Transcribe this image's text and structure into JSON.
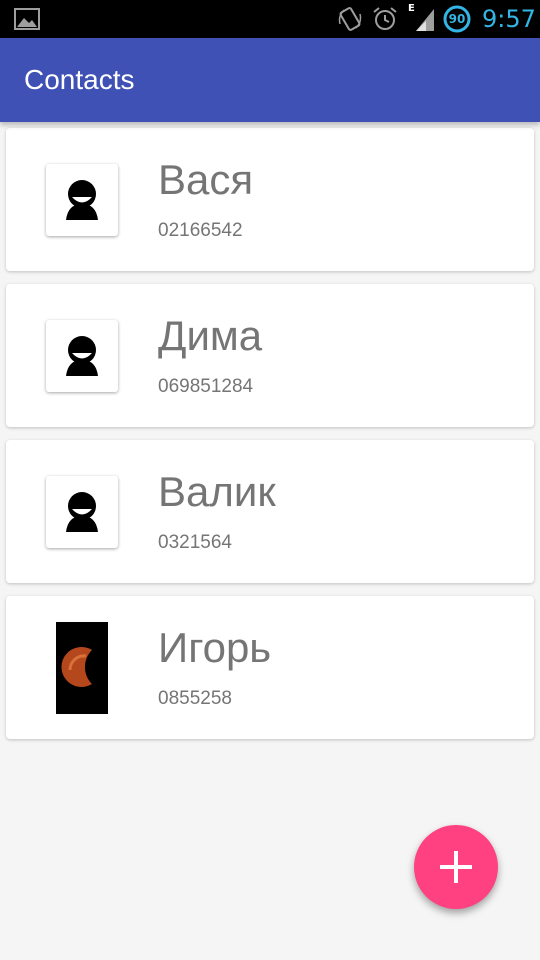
{
  "status_bar": {
    "time": "9:57",
    "battery_level": "90",
    "network_type": "E",
    "icons": [
      "gallery-icon",
      "rotate-icon",
      "alarm-icon",
      "signal-icon",
      "battery-icon"
    ],
    "accent_color": "#33b5e5"
  },
  "app_bar": {
    "title": "Contacts",
    "color": "#3f51b5"
  },
  "contacts": [
    {
      "name": "Вася",
      "phone": "02166542",
      "avatar": "default-avatar-icon"
    },
    {
      "name": "Дима",
      "phone": "069851284",
      "avatar": "default-avatar-icon"
    },
    {
      "name": "Валик",
      "phone": "0321564",
      "avatar": "default-avatar-icon"
    },
    {
      "name": "Игорь",
      "phone": "0855258",
      "avatar": "moon-photo"
    }
  ],
  "fab": {
    "icon": "plus-icon",
    "color": "#ff4081"
  }
}
